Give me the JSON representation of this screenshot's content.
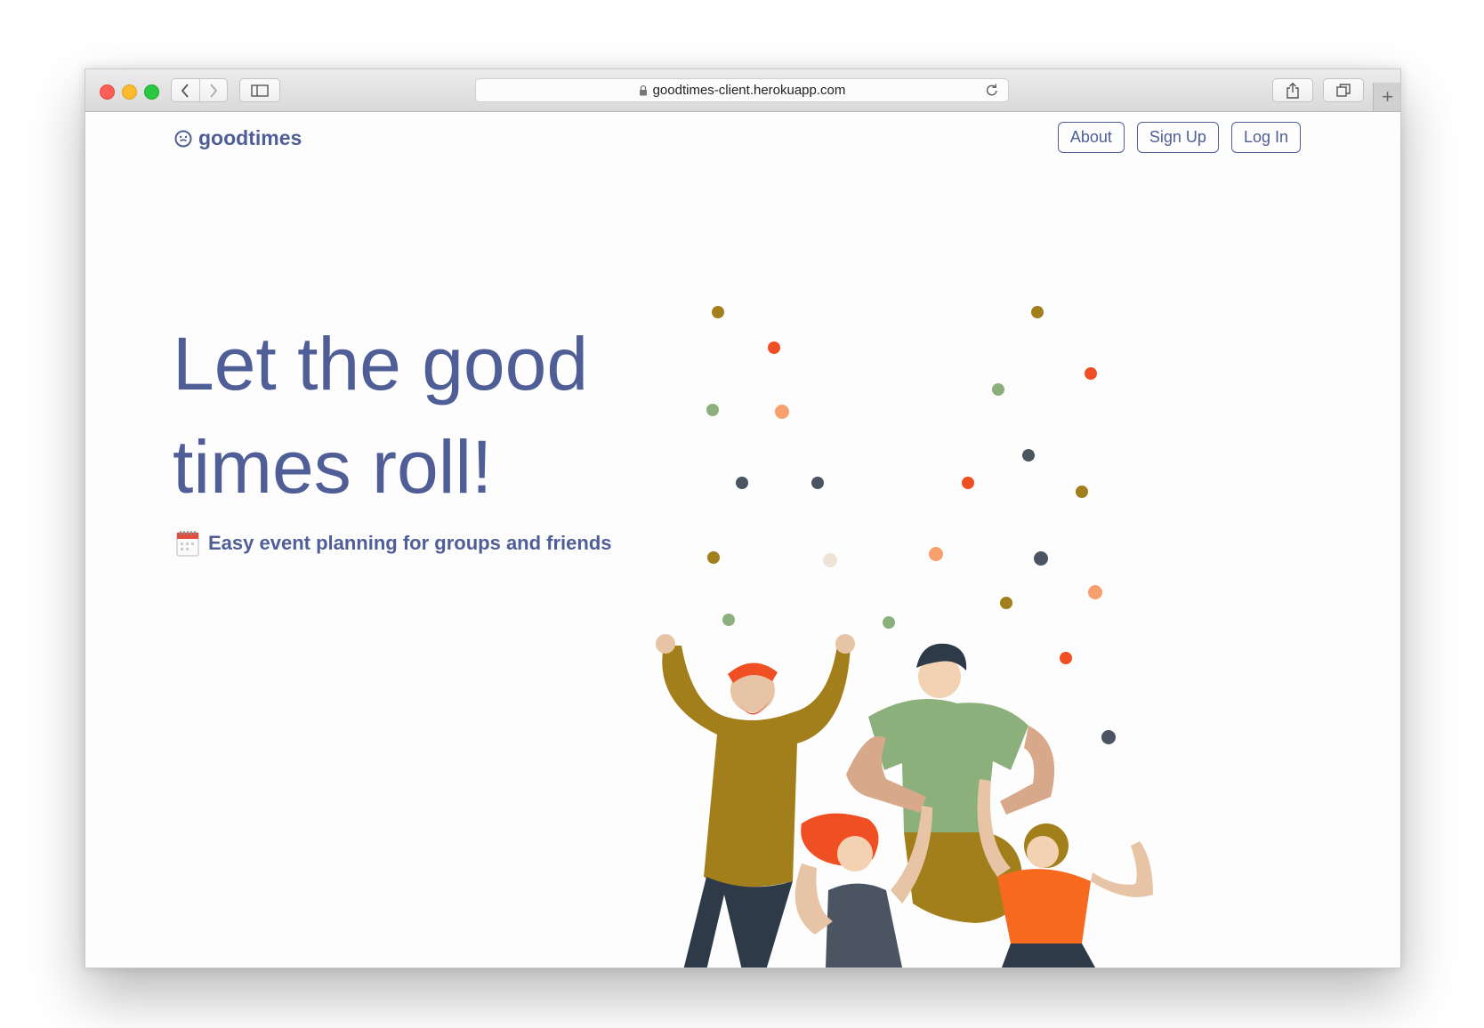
{
  "browser": {
    "url": "goodtimes-client.herokuapp.com"
  },
  "header": {
    "logo_text": "goodtimes",
    "nav": [
      {
        "label": "About"
      },
      {
        "label": "Sign Up"
      },
      {
        "label": "Log In"
      }
    ]
  },
  "hero": {
    "title_line1": "Let the good",
    "title_line2": "times roll!",
    "tagline_icon": "calendar-icon",
    "tagline": "Easy event planning for groups and friends"
  },
  "colors": {
    "brand": "#4f5e96",
    "confetti": [
      "#a27f1b",
      "#f04e23",
      "#8bb07b",
      "#f7a06e",
      "#4a5561",
      "#efe3d5"
    ]
  }
}
